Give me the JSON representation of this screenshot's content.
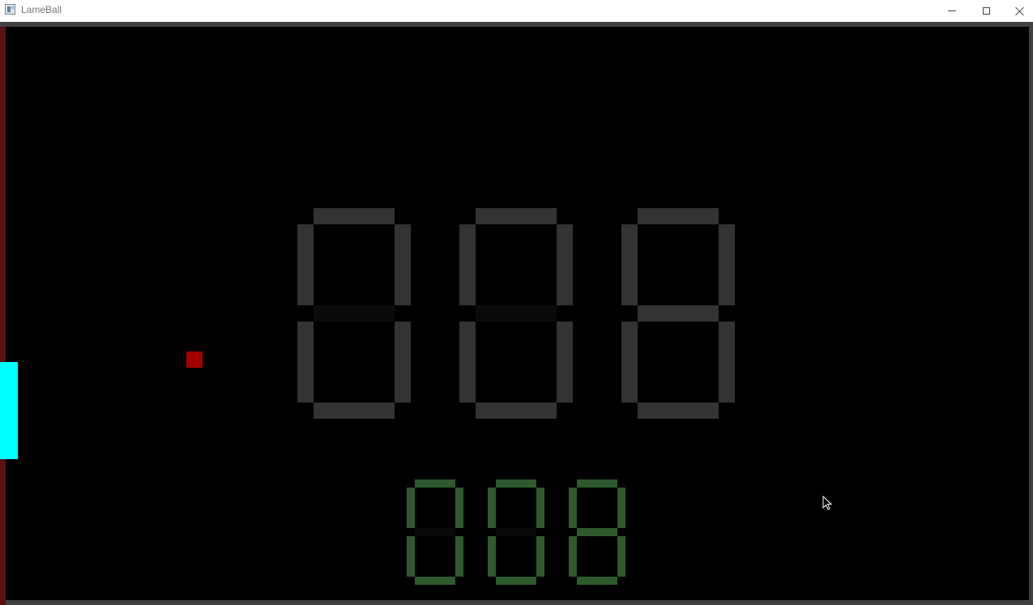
{
  "window": {
    "title": "LameBall",
    "icon": "app-window-icon",
    "controls": {
      "minimize_icon": "minimize-icon",
      "maximize_icon": "maximize-icon",
      "close_icon": "close-icon"
    }
  },
  "game": {
    "colors": {
      "background": "#000000",
      "frame": "#404040",
      "left_wall": "#5c1010",
      "paddle": "#00ffff",
      "ball": "#a30000",
      "big_digits_on": "#333333",
      "big_digits_off": "#0a0a0a",
      "small_digits_on": "#2e5a2e",
      "small_digits_off": "#0a0a0a"
    },
    "score_display": {
      "digits": [
        "0",
        "0",
        "8"
      ],
      "value": "008"
    },
    "secondary_display": {
      "digits": [
        "0",
        "0",
        "8"
      ],
      "value": "008"
    }
  }
}
